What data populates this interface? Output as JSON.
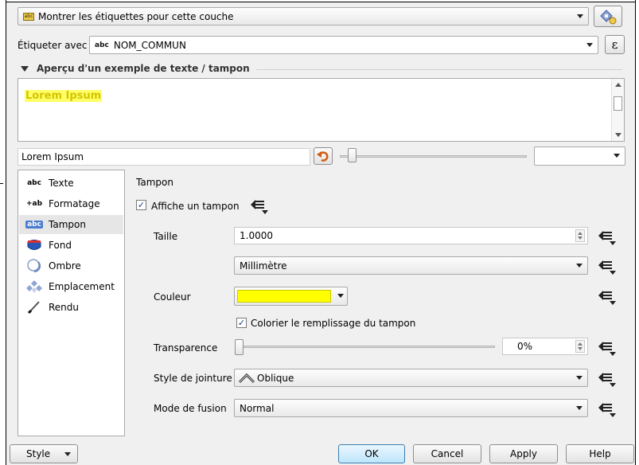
{
  "header": {
    "show_labels": "Montrer les étiquettes pour cette couche",
    "label_with": "Étiqueter avec",
    "field_badge": "abc",
    "field_value": "NOM_COMMUN",
    "expression_symbol": "ε"
  },
  "preview": {
    "title": "Aperçu d'un exemple de texte / tampon",
    "sample_text": "Lorem Ipsum",
    "input_value": "Lorem Ipsum"
  },
  "sidebar": {
    "items": [
      {
        "label": "Texte",
        "icon": "abc"
      },
      {
        "label": "Formatage",
        "icon": "+ab"
      },
      {
        "label": "Tampon",
        "icon": "abc"
      },
      {
        "label": "Fond"
      },
      {
        "label": "Ombre"
      },
      {
        "label": "Emplacement"
      },
      {
        "label": "Rendu"
      }
    ],
    "selected_index": 2
  },
  "buffer": {
    "section": "Tampon",
    "draw_buffer": "Affiche un tampon",
    "size_label": "Taille",
    "size_value": "1.0000",
    "unit_value": "Millimètre",
    "color_label": "Couleur",
    "color_value": "#ffff00",
    "fill_buffer": "Colorier le remplissage du tampon",
    "transparency_label": "Transparence",
    "transparency_value": "0%",
    "join_label": "Style de jointure",
    "join_value": "Oblique",
    "blend_label": "Mode de fusion",
    "blend_value": "Normal",
    "draw_buffer_checked": true,
    "fill_buffer_checked": true
  },
  "footer": {
    "style": "Style",
    "ok": "OK",
    "cancel": "Cancel",
    "apply": "Apply",
    "help": "Help"
  },
  "colors": {
    "highlight": "#ffff00",
    "accent_blue": "#2f5ea8"
  }
}
